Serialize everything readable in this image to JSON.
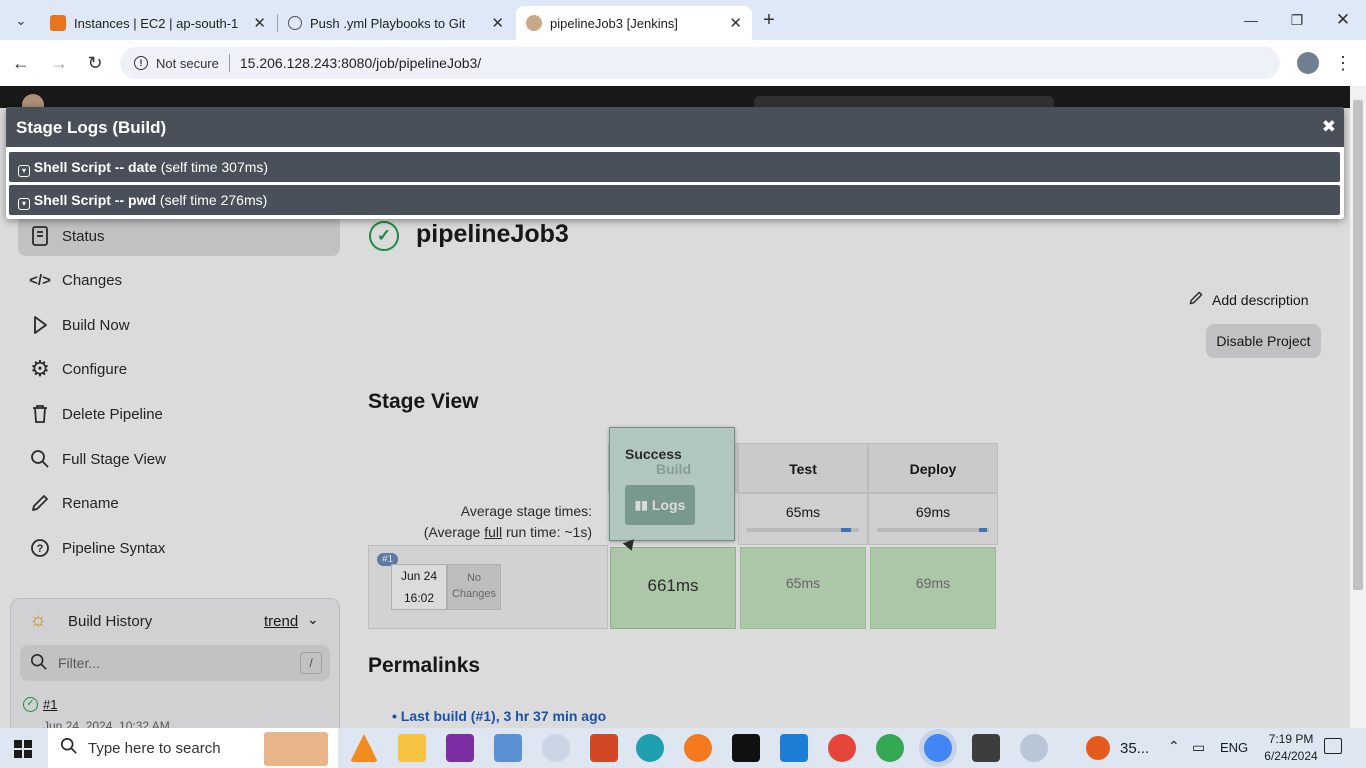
{
  "browser": {
    "tabs": [
      {
        "title": "Instances | EC2 | ap-south-1",
        "active": false
      },
      {
        "title": "Push .yml Playbooks to Git",
        "active": false
      },
      {
        "title": "pipelineJob3 [Jenkins]",
        "active": true
      }
    ],
    "security_label": "Not secure",
    "url": "15.206.128.243:8080/job/pipelineJob3/"
  },
  "sidebar": {
    "items": [
      {
        "label": "Status",
        "icon": "document-icon"
      },
      {
        "label": "Changes",
        "icon": "code-icon"
      },
      {
        "label": "Build Now",
        "icon": "play-icon"
      },
      {
        "label": "Configure",
        "icon": "gear-icon"
      },
      {
        "label": "Delete Pipeline",
        "icon": "trash-icon"
      },
      {
        "label": "Full Stage View",
        "icon": "search-icon"
      },
      {
        "label": "Rename",
        "icon": "pencil-icon"
      },
      {
        "label": "Pipeline Syntax",
        "icon": "help-icon"
      }
    ],
    "build_history": {
      "title": "Build History",
      "trend_label": "trend",
      "filter_placeholder": "Filter...",
      "filter_shortcut": "/",
      "build_link": "#1",
      "build_date": "Jun 24, 2024, 10:32 AM"
    }
  },
  "job": {
    "title": "pipelineJob3",
    "add_description": "Add description",
    "disable_button": "Disable Project"
  },
  "stage_view": {
    "heading": "Stage View",
    "avg_label": "Average stage times:",
    "avg_full_pre": "(Average ",
    "avg_full_link": "full",
    "avg_full_post": " run time: ~1s)",
    "stages": [
      "Build",
      "Test",
      "Deploy"
    ],
    "averages": [
      "",
      "65ms",
      "69ms"
    ],
    "build": {
      "badge": "#1",
      "date": "Jun 24",
      "time": "16:02",
      "changes": "No Changes"
    },
    "cells": [
      "661ms",
      "65ms",
      "69ms"
    ],
    "popover": {
      "status": "Success",
      "logs_button": "Logs"
    }
  },
  "permalinks": {
    "heading": "Permalinks",
    "items": [
      "Last build (#1), 3 hr 37 min ago"
    ]
  },
  "modal": {
    "title": "Stage Logs (Build)",
    "close": "✖",
    "logs": [
      {
        "name": "Shell Script -- date",
        "time": "(self time 307ms)"
      },
      {
        "name": "Shell Script -- pwd",
        "time": "(self time 276ms)"
      }
    ]
  },
  "taskbar": {
    "search_placeholder": "Type here to search",
    "tray_text": "35...",
    "language": "ENG",
    "time": "7:19 PM",
    "date": "6/24/2024"
  },
  "colors": {
    "success": "#1ea64b",
    "stage_green": "#c9e8c4",
    "modal_header": "#4a5059",
    "link": "#1e5fc7"
  }
}
